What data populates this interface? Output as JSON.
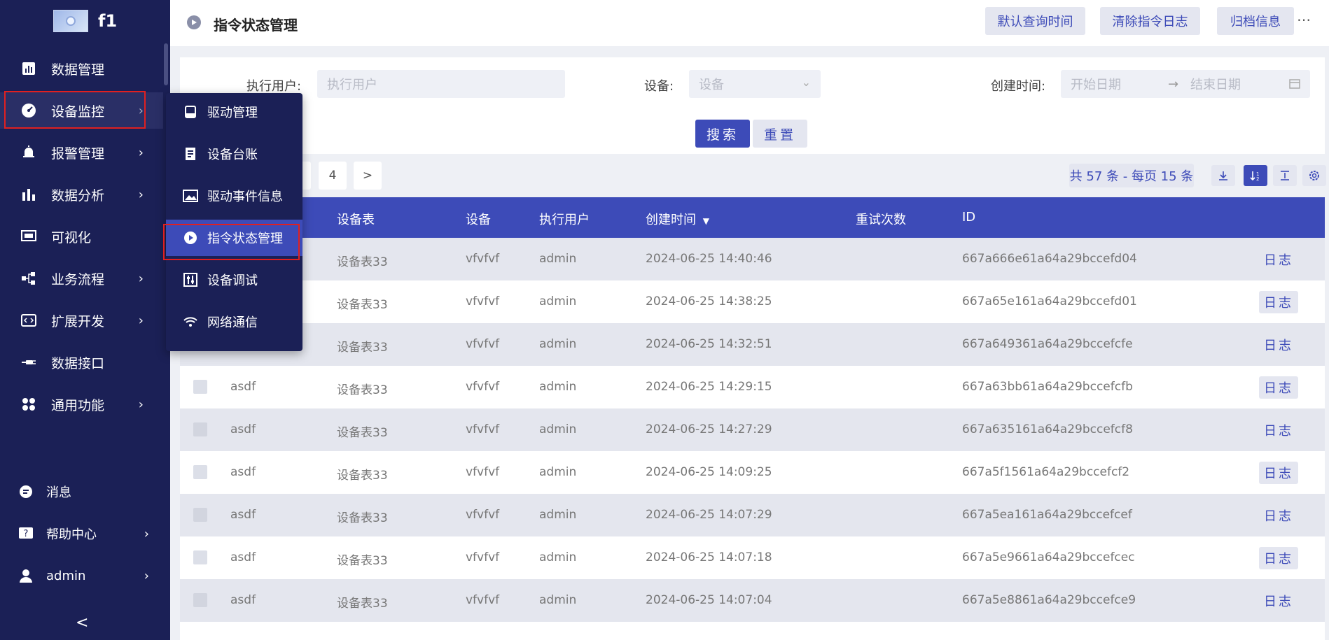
{
  "app": {
    "name": "f1"
  },
  "sidebar": {
    "items": [
      {
        "label": "数据管理",
        "icon": "bar-chart-icon"
      },
      {
        "label": "设备监控",
        "icon": "dashboard-icon"
      },
      {
        "label": "报警管理",
        "icon": "alarm-icon"
      },
      {
        "label": "数据分析",
        "icon": "analysis-icon"
      },
      {
        "label": "可视化",
        "icon": "monitor-icon"
      },
      {
        "label": "业务流程",
        "icon": "flow-icon"
      },
      {
        "label": "扩展开发",
        "icon": "code-icon"
      },
      {
        "label": "数据接口",
        "icon": "plug-icon"
      },
      {
        "label": "通用功能",
        "icon": "grid-icon"
      }
    ],
    "bottom": [
      {
        "label": "消息",
        "icon": "message-icon"
      },
      {
        "label": "帮助中心",
        "icon": "help-icon"
      },
      {
        "label": "admin",
        "icon": "user-icon"
      }
    ],
    "collapse_glyph": "<"
  },
  "flyout": {
    "items": [
      {
        "label": "驱动管理",
        "icon": "drive-icon"
      },
      {
        "label": "设备台账",
        "icon": "ledger-icon"
      },
      {
        "label": "驱动事件信息",
        "icon": "event-icon"
      },
      {
        "label": "指令状态管理",
        "icon": "command-icon"
      },
      {
        "label": "设备调试",
        "icon": "debug-icon"
      },
      {
        "label": "网络通信",
        "icon": "wifi-icon"
      }
    ]
  },
  "header": {
    "title": "指令状态管理",
    "buttons": [
      "默认查询时间",
      "清除指令日志",
      "归档信息"
    ],
    "more": "⋯"
  },
  "search": {
    "user_label": "执行用户:",
    "user_placeholder": "执行用户",
    "device_label": "设备:",
    "device_placeholder": "设备",
    "time_label": "创建时间:",
    "start_placeholder": "开始日期",
    "arrow": "→",
    "end_placeholder": "结束日期",
    "search_btn": "搜索",
    "reset_btn": "重置"
  },
  "pager": {
    "page": "4",
    "next": ">"
  },
  "toolbar": {
    "total": "共 57 条 - 每页 15 条"
  },
  "table": {
    "headers": {
      "table": "设备表",
      "device": "设备",
      "user": "执行用户",
      "created": "创建时间",
      "retry": "重试次数",
      "id": "ID"
    },
    "log_label": "日志",
    "rows": [
      {
        "name": "",
        "table": "设备表33",
        "device": "vfvfvf",
        "user": "admin",
        "created": "2024-06-25 14:40:46",
        "id": "667a666e61a64a29bccefd04"
      },
      {
        "name": "",
        "table": "设备表33",
        "device": "vfvfvf",
        "user": "admin",
        "created": "2024-06-25 14:38:25",
        "id": "667a65e161a64a29bccefd01"
      },
      {
        "name": "",
        "table": "设备表33",
        "device": "vfvfvf",
        "user": "admin",
        "created": "2024-06-25 14:32:51",
        "id": "667a649361a64a29bccefcfe"
      },
      {
        "name": "asdf",
        "table": "设备表33",
        "device": "vfvfvf",
        "user": "admin",
        "created": "2024-06-25 14:29:15",
        "id": "667a63bb61a64a29bccefcfb"
      },
      {
        "name": "asdf",
        "table": "设备表33",
        "device": "vfvfvf",
        "user": "admin",
        "created": "2024-06-25 14:27:29",
        "id": "667a635161a64a29bccefcf8"
      },
      {
        "name": "asdf",
        "table": "设备表33",
        "device": "vfvfvf",
        "user": "admin",
        "created": "2024-06-25 14:09:25",
        "id": "667a5f1561a64a29bccefcf2"
      },
      {
        "name": "asdf",
        "table": "设备表33",
        "device": "vfvfvf",
        "user": "admin",
        "created": "2024-06-25 14:07:29",
        "id": "667a5ea161a64a29bccefcef"
      },
      {
        "name": "asdf",
        "table": "设备表33",
        "device": "vfvfvf",
        "user": "admin",
        "created": "2024-06-25 14:07:18",
        "id": "667a5e9661a64a29bccefcec"
      },
      {
        "name": "asdf",
        "table": "设备表33",
        "device": "vfvfvf",
        "user": "admin",
        "created": "2024-06-25 14:07:04",
        "id": "667a5e8861a64a29bccefce9"
      }
    ]
  }
}
